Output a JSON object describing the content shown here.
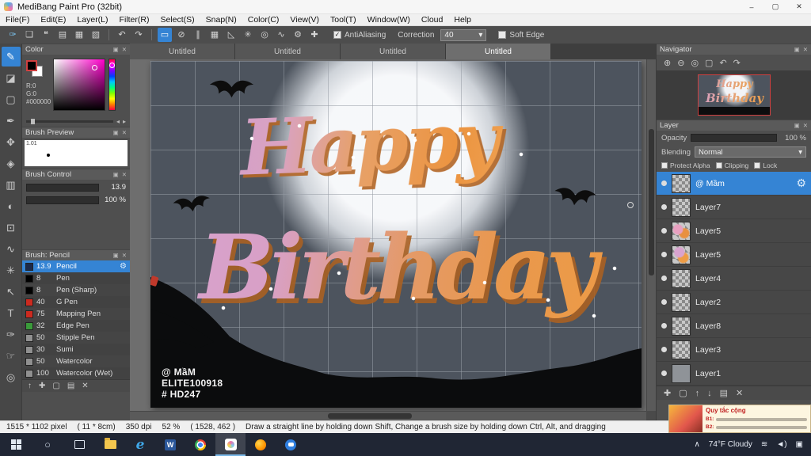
{
  "window": {
    "title": "MediBang Paint Pro (32bit)"
  },
  "icons": {
    "minimize": "–",
    "maximize": "▢",
    "close": "✕",
    "undo": "↶",
    "redo": "↷",
    "panel_popout": "▣",
    "panel_close": "✕",
    "dropdown_arrow": "▾",
    "check": "✓",
    "gear": "⚙",
    "zoom_in": "⊕",
    "zoom_out": "⊖",
    "zoom_reset": "◎",
    "fit_window": "▢",
    "rotate_left": "↶",
    "rotate_right": "↷",
    "chevron_up": "∧",
    "wifi": "≋",
    "volume": "◄)",
    "action_center": "▣",
    "search": "○",
    "color_prev": "◂",
    "color_next": "▸",
    "add": "✚",
    "duplicate": "▢",
    "folder": "▤",
    "grid": "▦",
    "delete": "✕",
    "up": "↑",
    "down": "↓"
  },
  "menu": {
    "items": [
      "File(F)",
      "Edit(E)",
      "Layer(L)",
      "Filter(R)",
      "Select(S)",
      "Snap(N)",
      "Color(C)",
      "View(V)",
      "Tool(T)",
      "Window(W)",
      "Cloud",
      "Help"
    ]
  },
  "toolbar": {
    "file_icons": [
      {
        "name": "stabilizer",
        "glyph": "✑"
      },
      {
        "name": "new-canvas",
        "glyph": "❏"
      },
      {
        "name": "comment",
        "glyph": "❝"
      },
      {
        "name": "save",
        "glyph": "▤"
      },
      {
        "name": "grid-view",
        "glyph": "▦"
      },
      {
        "name": "materials",
        "glyph": "▧"
      }
    ],
    "snap_icons": [
      {
        "name": "select-round",
        "glyph": "▭"
      },
      {
        "name": "snap-off",
        "glyph": "⊘"
      },
      {
        "name": "snap-parallel",
        "glyph": "∥"
      },
      {
        "name": "snap-crisscross",
        "glyph": "▦"
      },
      {
        "name": "snap-vanishing",
        "glyph": "◺"
      },
      {
        "name": "snap-radial",
        "glyph": "✳"
      },
      {
        "name": "snap-circle",
        "glyph": "◎"
      },
      {
        "name": "snap-curve",
        "glyph": "∿"
      },
      {
        "name": "snap-settings",
        "glyph": "⚙"
      },
      {
        "name": "snap-guide",
        "glyph": "✚"
      }
    ],
    "antialiasing_label": "AntiAliasing",
    "correction_label": "Correction",
    "correction_value": "40",
    "soft_edge_label": "Soft Edge"
  },
  "tools": {
    "items": [
      {
        "name": "brush",
        "glyph": "✎"
      },
      {
        "name": "eraser",
        "glyph": "◪"
      },
      {
        "name": "select",
        "glyph": "▢"
      },
      {
        "name": "pen",
        "glyph": "✒"
      },
      {
        "name": "move",
        "glyph": "✥"
      },
      {
        "name": "fill",
        "glyph": "◈"
      },
      {
        "name": "gradient",
        "glyph": "▥"
      },
      {
        "name": "blur",
        "glyph": "◐"
      },
      {
        "name": "marquee",
        "glyph": "⊡"
      },
      {
        "name": "lasso",
        "glyph": "∿"
      },
      {
        "name": "magic-wand",
        "glyph": "✳"
      },
      {
        "name": "operation",
        "glyph": "↖"
      },
      {
        "name": "text",
        "glyph": "T"
      },
      {
        "name": "eyedropper",
        "glyph": "✑"
      },
      {
        "name": "hand",
        "glyph": "☞"
      },
      {
        "name": "zoom",
        "glyph": "◎"
      }
    ]
  },
  "color_panel": {
    "title": "Color",
    "r": "R:0",
    "g": "G:0",
    "hex": "#000000"
  },
  "brush_preview": {
    "title": "Brush Preview",
    "scale": "1.01"
  },
  "brush_control": {
    "title": "Brush Control",
    "size": "13.9",
    "opacity": "100 %"
  },
  "brush_panel": {
    "title": "Brush: Pencil",
    "items": [
      {
        "size": "13.9",
        "name": "Pencil",
        "color": "#1b2a4a"
      },
      {
        "size": "8",
        "name": "Pen",
        "color": "#000000"
      },
      {
        "size": "8",
        "name": "Pen (Sharp)",
        "color": "#000000"
      },
      {
        "size": "40",
        "name": "G Pen",
        "color": "#cc2a1f"
      },
      {
        "size": "75",
        "name": "Mapping Pen",
        "color": "#cc2a1f"
      },
      {
        "size": "32",
        "name": "Edge Pen",
        "color": "#3a9a3a"
      },
      {
        "size": "50",
        "name": "Stipple Pen",
        "color": "#909090"
      },
      {
        "size": "30",
        "name": "Sumi",
        "color": "#909090"
      },
      {
        "size": "50",
        "name": "Watercolor",
        "color": "#909090"
      },
      {
        "size": "100",
        "name": "Watercolor (Wet)",
        "color": "#909090"
      }
    ]
  },
  "tabs": {
    "items": [
      "Untitled",
      "Untitled",
      "Untitled",
      "Untitled"
    ]
  },
  "canvas": {
    "line1": "Happy",
    "line2": "Birthday",
    "watermark1": "@ MầM",
    "watermark2": "ELITE100918",
    "watermark3": "# HD247"
  },
  "navigator": {
    "title": "Navigator"
  },
  "layer_panel": {
    "title": "Layer",
    "opacity_label": "Opacity",
    "opacity_value": "100 %",
    "blending_label": "Blending",
    "blending_value": "Normal",
    "protect_alpha_label": "Protect Alpha",
    "clipping_label": "Clipping",
    "lock_label": "Lock",
    "layers": [
      {
        "name": "@ Mầm",
        "thumb": "checker"
      },
      {
        "name": "Layer7",
        "thumb": "checker"
      },
      {
        "name": "Layer5",
        "thumb": "art"
      },
      {
        "name": "Layer5",
        "thumb": "art2"
      },
      {
        "name": "Layer4",
        "thumb": "checker"
      },
      {
        "name": "Layer2",
        "thumb": "checker"
      },
      {
        "name": "Layer8",
        "thumb": "checker"
      },
      {
        "name": "Layer3",
        "thumb": "checker"
      },
      {
        "name": "Layer1",
        "thumb": "gray"
      }
    ]
  },
  "promo": {
    "title": "Quy tắc cộng",
    "tag1": "B1:",
    "tag2": "B2:"
  },
  "status_bar": {
    "resolution": "1515 * 1102 pixel",
    "size_cm": "( 11 * 8cm)",
    "dpi": "350 dpi",
    "zoom": "52 %",
    "coords": "( 1528, 462 )",
    "hint": "Draw a straight line by holding down Shift, Change a brush size by holding down Ctrl, Alt, and dragging"
  },
  "taskbar": {
    "weather": "74°F Cloudy"
  },
  "accent_colors": {
    "selection_blue": "#3584d4",
    "canvas_bg": "#4d545e",
    "taskbar_bg": "#202634"
  }
}
